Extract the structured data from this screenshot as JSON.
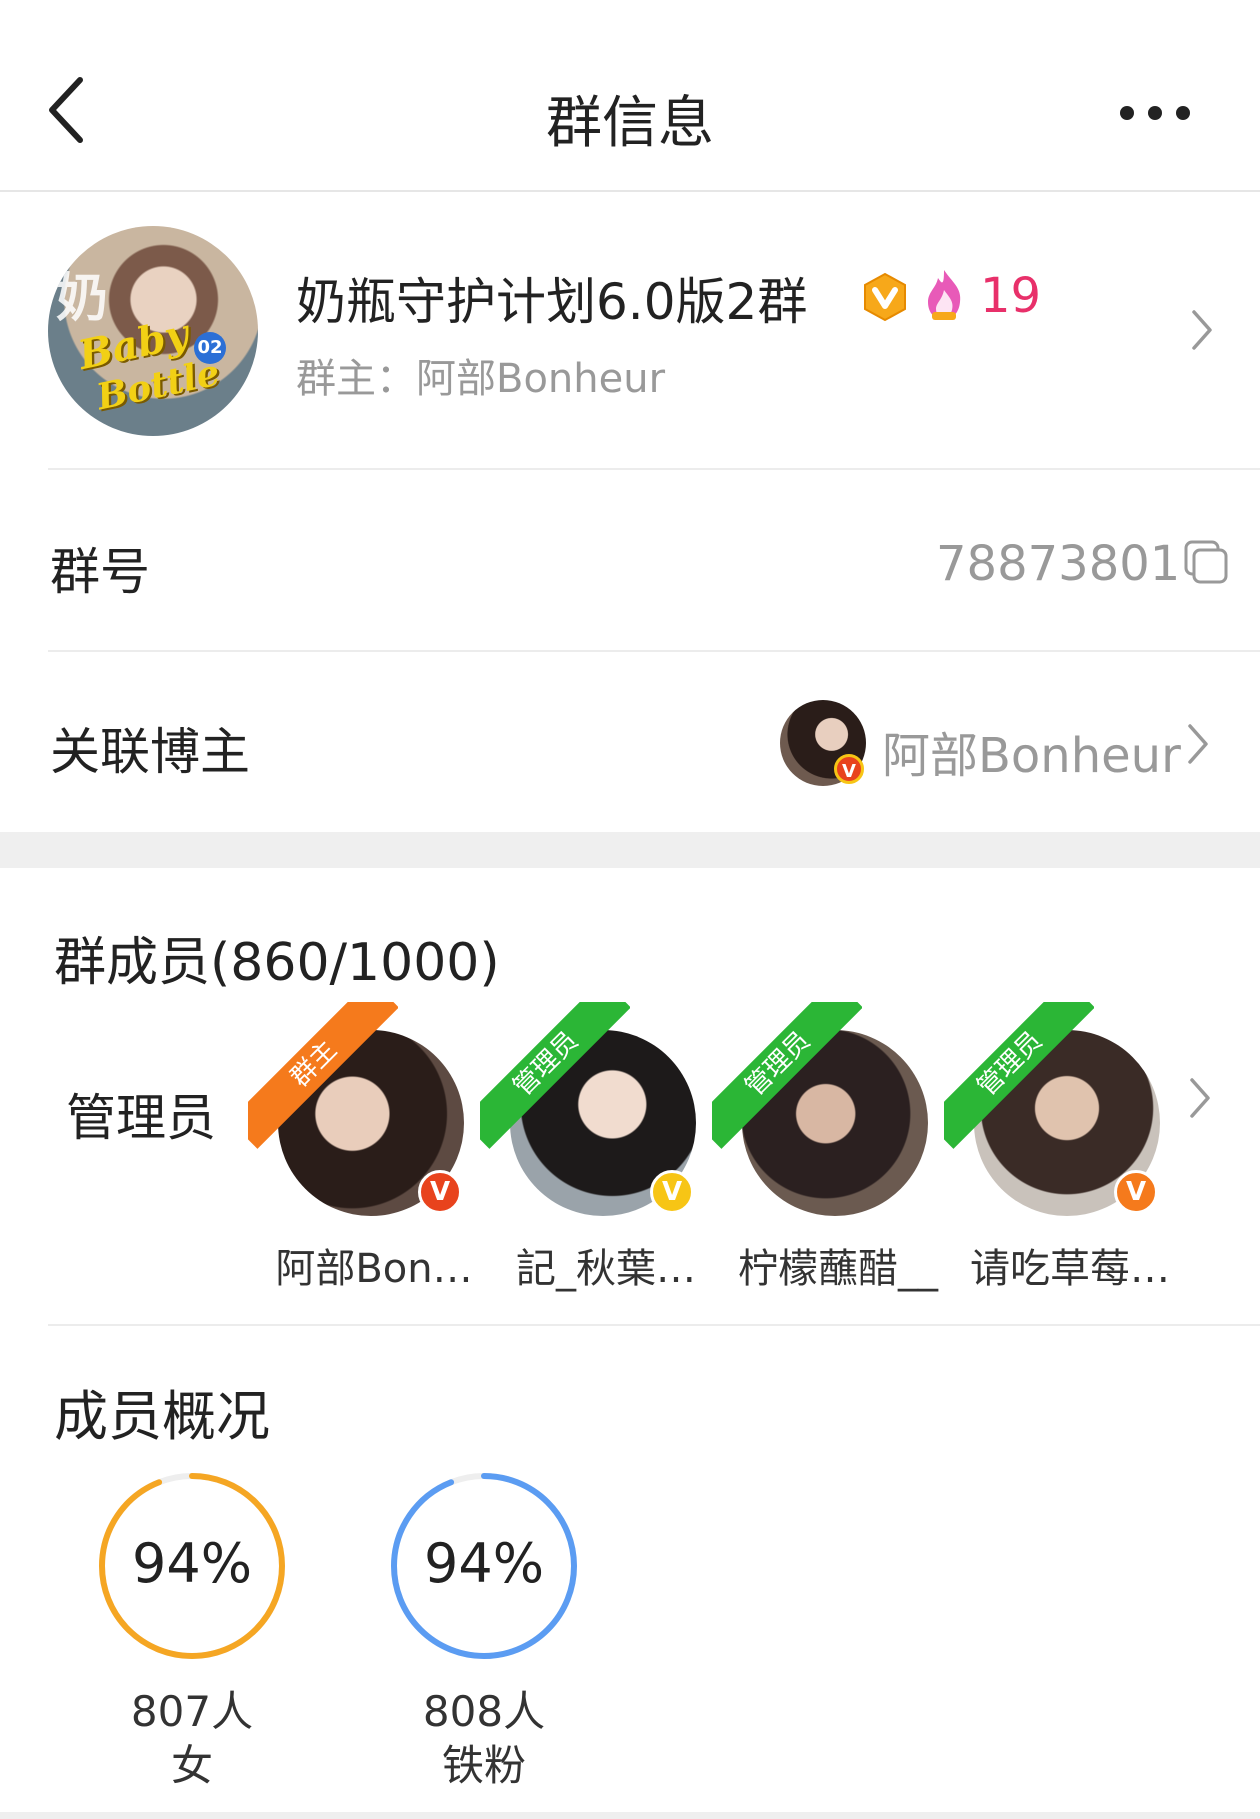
{
  "header": {
    "title": "群信息"
  },
  "group": {
    "name": "奶瓶守护计划6.0版2群",
    "hot_count": "19",
    "owner_line": "群主：阿部Bonheur",
    "avatar_badge": "02",
    "avatar_text_1": "Baby",
    "avatar_text_2": "Bottle",
    "avatar_char": "奶"
  },
  "group_id_row": {
    "label": "群号",
    "value": "78873801"
  },
  "blogger_row": {
    "label": "关联博主",
    "name": "阿部Bonheur",
    "badge": "V"
  },
  "members": {
    "title": "群成员(860/1000)",
    "admin_label": "管理员",
    "list": [
      {
        "name": "阿部Bon…",
        "role": "群主",
        "role_color": "#f57a1c",
        "v_color": "#e8431d",
        "v": "V"
      },
      {
        "name": "記_秋葉…",
        "role": "管理员",
        "role_color": "#2bb636",
        "v_color": "#f7c515",
        "v": "V"
      },
      {
        "name": "柠檬蘸醋__",
        "role": "管理员",
        "role_color": "#2bb636",
        "v_color": "",
        "v": ""
      },
      {
        "name": "请吃草莓…",
        "role": "管理员",
        "role_color": "#2bb636",
        "v_color": "#f57a1c",
        "v": "V"
      }
    ]
  },
  "overview": {
    "title": "成员概况",
    "stats": [
      {
        "percent_text": "94%",
        "percent": 94,
        "count": "807人",
        "label": "女",
        "color": "#f5a623"
      },
      {
        "percent_text": "94%",
        "percent": 94,
        "count": "808人",
        "label": "铁粉",
        "color": "#5b9cf2"
      }
    ]
  },
  "icons": {
    "back": "chevron-left-icon",
    "more": "more-dots-icon",
    "verified": "verified-v-icon",
    "fire": "fire-icon",
    "copy": "copy-icon",
    "arrow": "chevron-right-icon"
  }
}
